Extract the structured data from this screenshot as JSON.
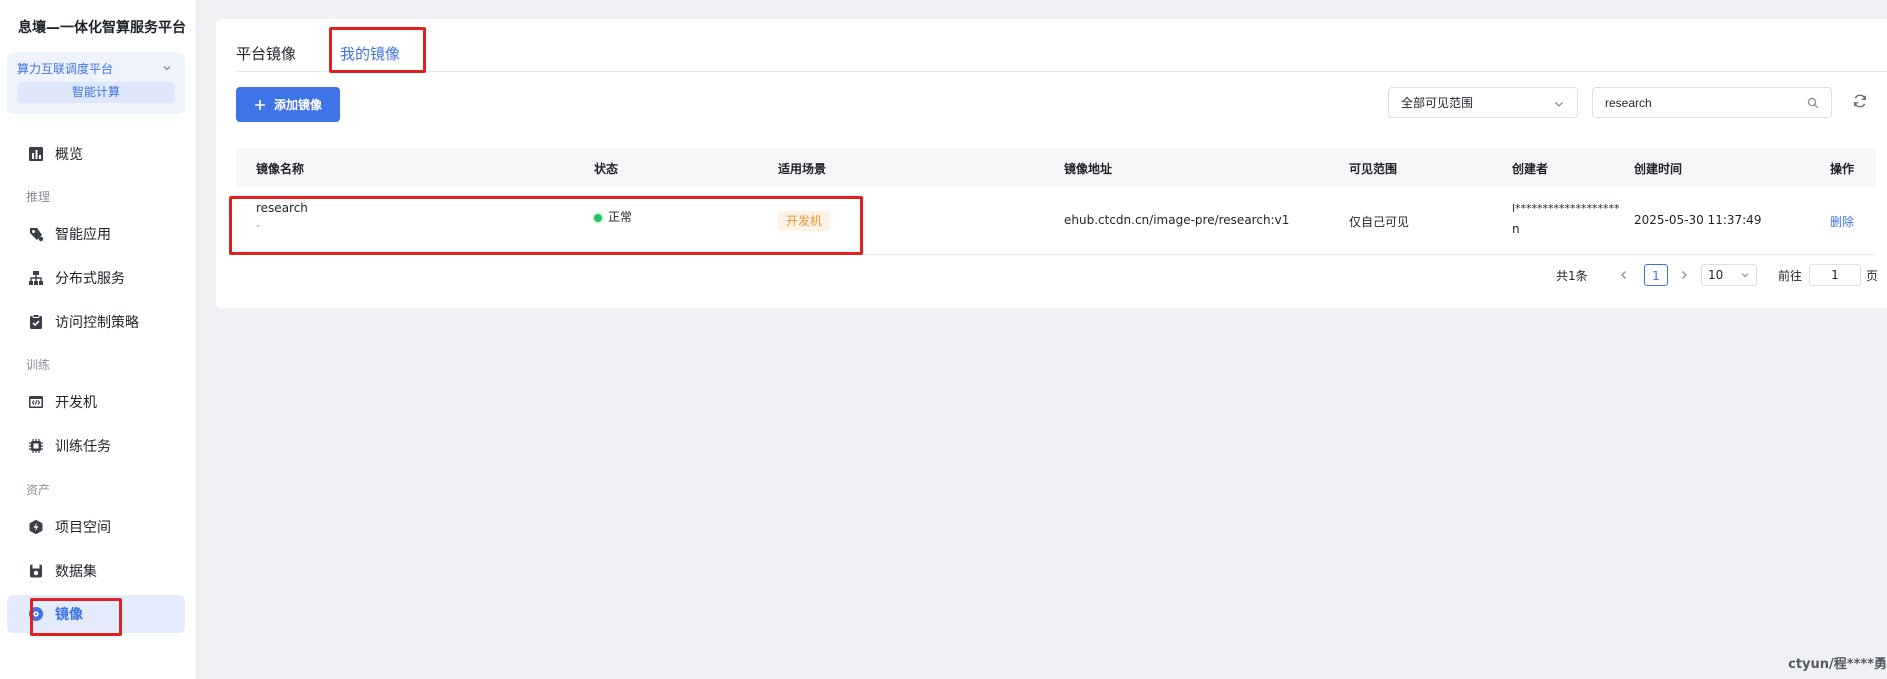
{
  "sidebar": {
    "brand": "息壤—一体化智算服务平台",
    "scope": {
      "label": "算力互联调度平台",
      "sub": "智能计算"
    },
    "items": [
      {
        "label": "概览",
        "icon": "bar-chart-icon"
      },
      {
        "label": "智能应用",
        "icon": "smart-app-icon"
      },
      {
        "label": "分布式服务",
        "icon": "distributed-icon"
      },
      {
        "label": "访问控制策略",
        "icon": "policy-icon"
      },
      {
        "label": "开发机",
        "icon": "code-icon"
      },
      {
        "label": "训练任务",
        "icon": "chip-icon"
      },
      {
        "label": "项目空间",
        "icon": "project-icon"
      },
      {
        "label": "数据集",
        "icon": "dataset-icon"
      },
      {
        "label": "镜像",
        "icon": "image-icon",
        "active": true
      }
    ],
    "groups": {
      "infer": "推理",
      "train": "训练",
      "asset": "资产"
    }
  },
  "tabs": {
    "platform": "平台镜像",
    "mine": "我的镜像"
  },
  "toolbar": {
    "add_label": "添加镜像",
    "scope_select": "全部可见范围",
    "search_value": "research"
  },
  "table": {
    "headers": [
      "镜像名称",
      "状态",
      "适用场景",
      "镜像地址",
      "可见范围",
      "创建者",
      "创建时间",
      "操作"
    ],
    "rows": [
      {
        "name": "research",
        "desc": "-",
        "status": "正常",
        "scene": "开发机",
        "address": "ehub.ctcdn.cn/image-pre/research:v1",
        "visibility": "仅自己可见",
        "creator_line1": "l*******************",
        "creator_line2": "n",
        "created": "2025-05-30 11:37:49",
        "action": "删除"
      }
    ]
  },
  "pagination": {
    "total": "共1条",
    "page": "1",
    "size": "10",
    "goto": "前往",
    "goto_value": "1",
    "page_unit": "页"
  },
  "watermark": "ctyun/程****勇",
  "colors": {
    "accent": "#3f73e8",
    "highlight": "#e02020",
    "status_ok": "#22c55e",
    "tag_text": "#f0922e"
  }
}
